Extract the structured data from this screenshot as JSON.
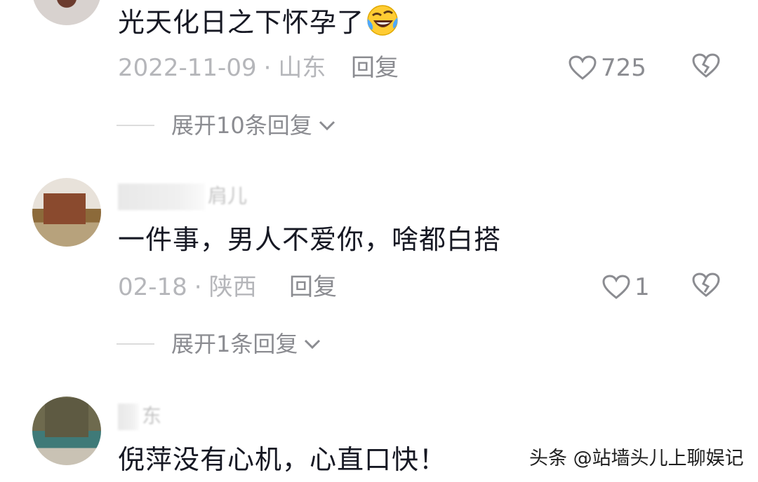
{
  "comments": [
    {
      "text": "光天化日之下怀孕了",
      "emoji": "laughing-crying-emoji",
      "date": "2022-11-09",
      "location": "山东",
      "reply_label": "回复",
      "likes": "725",
      "expand_label": "展开10条回复"
    },
    {
      "username_visible": "肩儿",
      "text": "一件事，男人不爱你，啥都白搭",
      "date": "02-18",
      "location": "陕西",
      "reply_label": "回复",
      "likes": "1",
      "expand_label": "展开1条回复"
    },
    {
      "username_visible": "东",
      "text": "倪萍没有心机，心直口快！"
    }
  ],
  "separator": "·",
  "watermark": "头条 @站墙头儿上聊娱记",
  "icons": {
    "like": "heart-outline-icon",
    "dislike": "broken-heart-icon",
    "expand": "chevron-down-icon"
  },
  "colors": {
    "text": "#161823",
    "meta": "#b5b6ba",
    "action": "#8b8c91"
  }
}
